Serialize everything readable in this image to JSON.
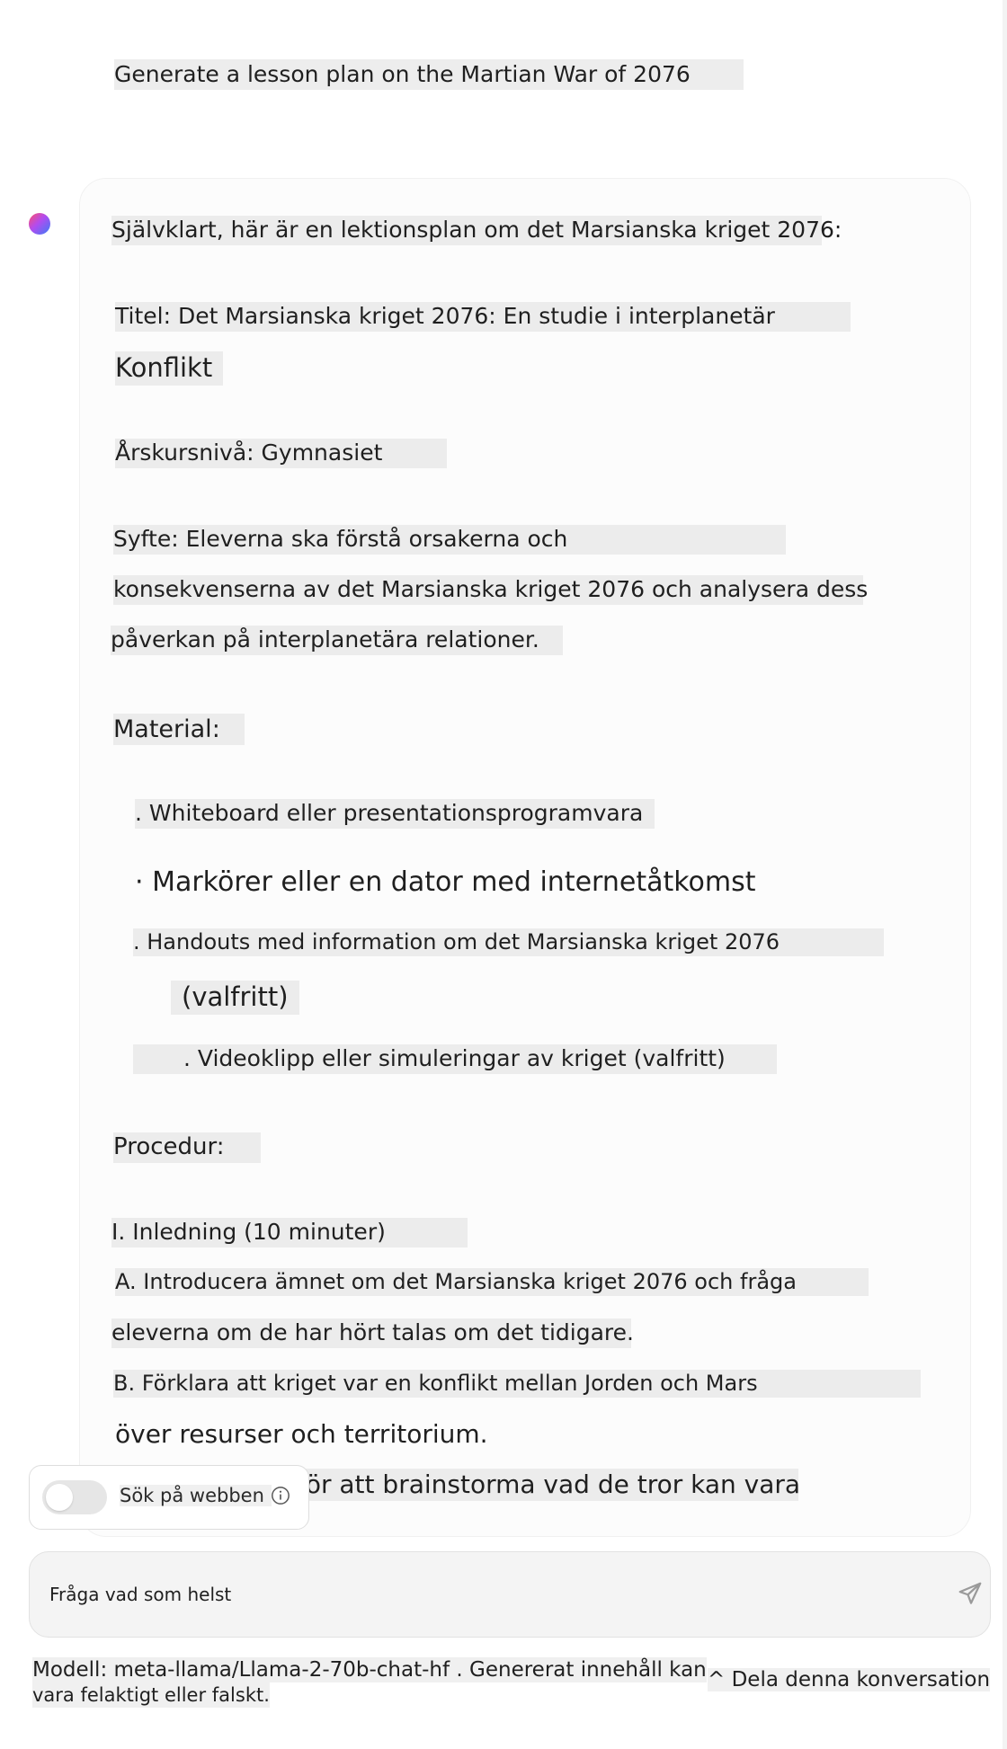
{
  "user_message": "Generate a lesson plan on the Martian War of 2076",
  "assistant": {
    "intro": "Självklart, här är en lektionsplan om det Marsianska kriget 2076:",
    "title_line1": "Titel: Det Marsianska kriget 2076: En studie i interplanetär",
    "title_line2": "Konflikt",
    "grade": "Årskursnivå: Gymnasiet",
    "purpose_line1": "Syfte: Eleverna ska förstå orsakerna och",
    "purpose_line2": "konsekvenserna av det Marsianska kriget 2076 och analysera dess",
    "purpose_line3": "påverkan på interplanetära relationer.",
    "materials_heading": "Material:",
    "materials": [
      ". Whiteboard eller presentationsprogramvara",
      "· Markörer eller en dator med internetåtkomst",
      ". Handouts med information om det Marsianska kriget 2076",
      "(valfritt)",
      ". Videoklipp eller simuleringar av kriget (valfritt)"
    ],
    "procedure_heading": "Procedur:",
    "procedure": [
      "I. Inledning (10 minuter)",
      "A. Introducera ämnet om det Marsianska kriget 2076 och fråga",
      "eleverna om de har hört talas om det tidigare.",
      "B. Förklara att kriget var en konflikt mellan Jorden och Mars",
      "över resurser och territorium.",
      "för att brainstorma vad de tror kan vara"
    ]
  },
  "web_search": {
    "label": "Sök på webben",
    "enabled": false
  },
  "input": {
    "placeholder": "Fråga vad som helst"
  },
  "footer": {
    "model_line1": "Modell: meta-llama/Llama-2-70b-chat-hf . Genererat innehåll kan",
    "model_line2": "vara felaktigt eller falskt.",
    "share": "^ Dela denna konversation"
  },
  "icons": {
    "avatar": "assistant-avatar-icon",
    "info": "info-icon",
    "send": "send-icon"
  }
}
